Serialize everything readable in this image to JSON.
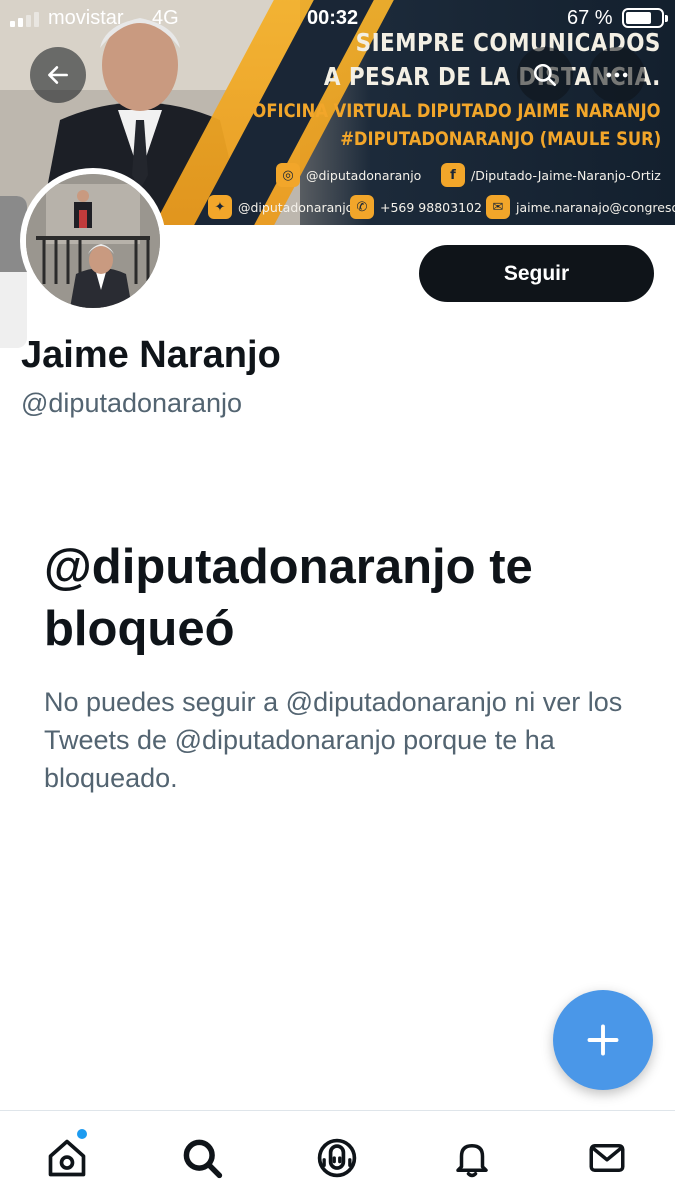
{
  "status_bar": {
    "carrier": "movistar",
    "network": "4G",
    "time": "00:32",
    "battery": "67 %",
    "battery_level": 0.67
  },
  "banner": {
    "line1": "SIEMPRE COMUNICADOS",
    "line2": "A PESAR DE LA DISTANCIA.",
    "line3": "OFICINA VIRTUAL DIPUTADO JAIME NARANJO",
    "line4": "#DIPUTADONARANJO (MAULE SUR)",
    "instagram": "@diputadonaranjo",
    "facebook": "/Diputado-Jaime-Naranjo-Ortiz",
    "twitter": "@diputadonaranjo",
    "whatsapp": "+569 98803102",
    "email": "jaime.naranajo@congreso.cl"
  },
  "profile": {
    "name": "Jaime Naranjo",
    "handle": "@diputadonaranjo",
    "follow_label": "Seguir"
  },
  "blocked": {
    "title": "@diputadonaranjo te bloqueó",
    "description": "No puedes seguir a @diputadonaranjo ni ver los Tweets de @diputadonaranjo porque te ha bloqueado."
  },
  "colors": {
    "accent": "#1d9bf0",
    "fab": "#4a97e8",
    "text_primary": "#0f1419",
    "text_secondary": "#536471",
    "banner_orange": "#f2a62a"
  },
  "icons": {
    "back": "arrow-left-icon",
    "search": "search-icon",
    "more": "more-icon",
    "compose": "plus-icon",
    "home": "home-icon",
    "explore": "search-icon",
    "spaces": "spaces-icon",
    "notifications": "bell-icon",
    "messages": "mail-icon"
  }
}
